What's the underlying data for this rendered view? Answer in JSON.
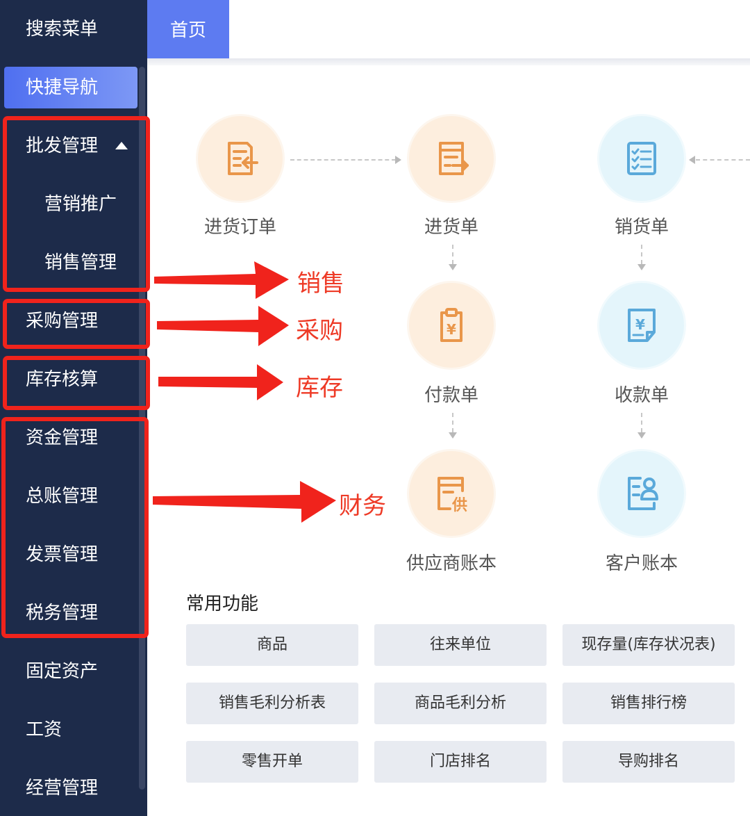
{
  "sidebar": {
    "search": "搜索菜单",
    "quick_nav": "快捷导航",
    "items": [
      {
        "label": "批发管理"
      },
      {
        "label": "营销推广"
      },
      {
        "label": "销售管理"
      },
      {
        "label": "采购管理"
      },
      {
        "label": "库存核算"
      },
      {
        "label": "资金管理"
      },
      {
        "label": "总账管理"
      },
      {
        "label": "发票管理"
      },
      {
        "label": "税务管理"
      },
      {
        "label": "固定资产"
      },
      {
        "label": "工资"
      },
      {
        "label": "经营管理"
      }
    ]
  },
  "tabs": [
    {
      "label": "首页"
    }
  ],
  "flow": {
    "nodes": [
      {
        "label": "进货订单",
        "icon": "purchase-order-icon",
        "color": "#e9964a"
      },
      {
        "label": "进货单",
        "icon": "purchase-receipt-icon",
        "color": "#e9964a"
      },
      {
        "label": "销货单",
        "icon": "sales-checklist-icon",
        "color": "#5aa9da"
      },
      {
        "label": "付款单",
        "icon": "payment-clipboard-icon",
        "color": "#e9964a"
      },
      {
        "label": "收款单",
        "icon": "receipt-note-icon",
        "color": "#5aa9da"
      },
      {
        "label": "供应商账本",
        "icon": "supplier-ledger-icon",
        "color": "#e9964a"
      },
      {
        "label": "客户账本",
        "icon": "customer-ledger-icon",
        "color": "#5aa9da"
      }
    ],
    "glyphs": {
      "yen": "¥",
      "supply": "供"
    }
  },
  "annotations": [
    {
      "label": "销售"
    },
    {
      "label": "采购"
    },
    {
      "label": "库存"
    },
    {
      "label": "财务"
    }
  ],
  "common_functions": {
    "title": "常用功能",
    "buttons": [
      "商品",
      "往来单位",
      "现存量(库存状况表)",
      "销售毛利分析表",
      "商品毛利分析",
      "销售排行榜",
      "零售开单",
      "门店排名",
      "导购排名"
    ]
  },
  "colors": {
    "sidebar_bg": "#1d2b4a",
    "accent": "#5d7bf1",
    "annotation_red": "#f0231c",
    "orange_icon": "#e9964a",
    "blue_icon": "#5aa9da"
  }
}
